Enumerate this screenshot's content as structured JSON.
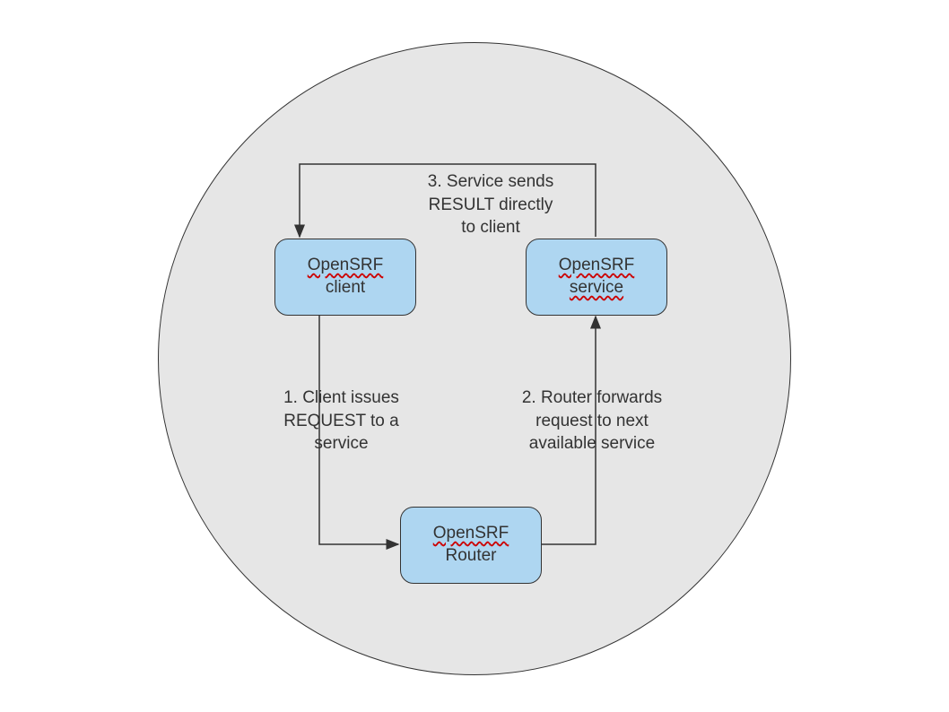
{
  "nodes": {
    "client": {
      "line1": "OpenSRF",
      "line2": "client"
    },
    "service": {
      "line1": "OpenSRF",
      "line2": "service"
    },
    "router": {
      "line1": "OpenSRF",
      "line2": "Router"
    }
  },
  "edges": {
    "step1": {
      "line1": "1. Client issues",
      "line2": "REQUEST to a",
      "line3": "service"
    },
    "step2": {
      "line1": "2. Router forwards",
      "line2": "request to next",
      "line3": "available service"
    },
    "step3": {
      "line1": "3. Service sends",
      "line2": "RESULT directly",
      "line3": "to client"
    }
  },
  "diagram": {
    "description": "OpenSRF request-response flow through the router",
    "flow": [
      {
        "from": "OpenSRF client",
        "to": "OpenSRF Router",
        "text": "1. Client issues REQUEST to a service"
      },
      {
        "from": "OpenSRF Router",
        "to": "OpenSRF service",
        "text": "2. Router forwards request to next available service"
      },
      {
        "from": "OpenSRF service",
        "to": "OpenSRF client",
        "text": "3. Service sends RESULT directly to client"
      }
    ]
  }
}
